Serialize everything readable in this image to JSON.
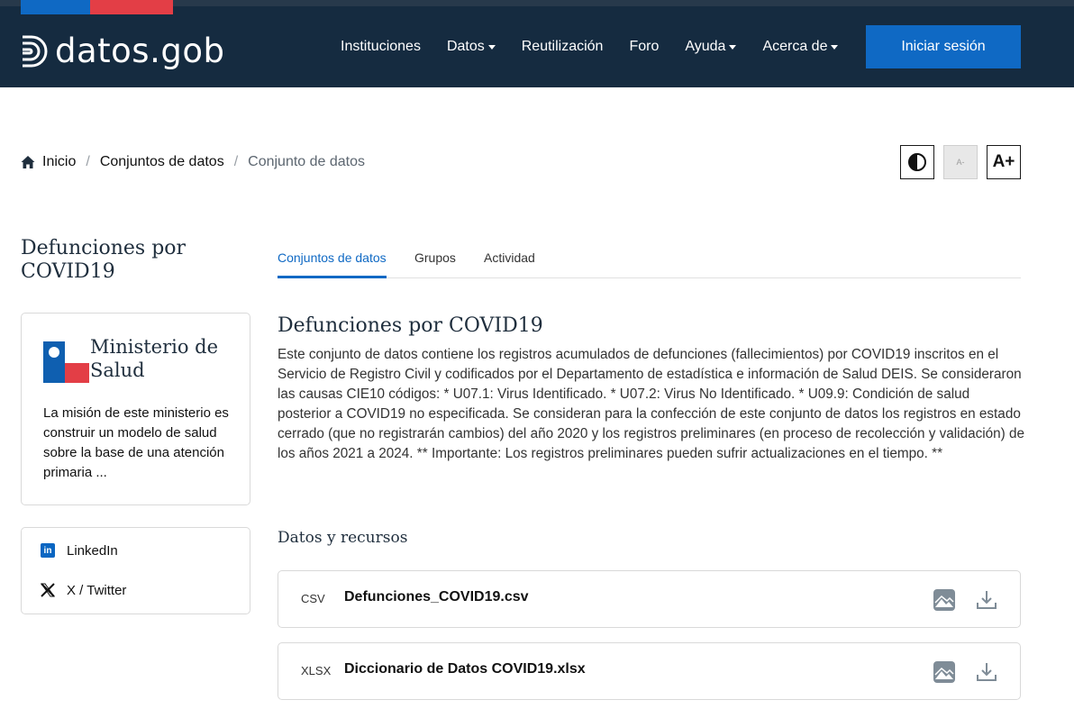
{
  "header": {
    "logo_text": "datos.gob",
    "nav": [
      {
        "label": "Instituciones"
      },
      {
        "label": "Datos"
      },
      {
        "label": "Reutilización"
      },
      {
        "label": "Foro"
      },
      {
        "label": "Ayuda"
      },
      {
        "label": "Acerca de"
      }
    ],
    "login_label": "Iniciar sesión"
  },
  "breadcrumb": {
    "home": "Inicio",
    "section": "Conjuntos de datos",
    "current": "Conjunto de datos"
  },
  "accessibility": {
    "smaller_label": "A-",
    "bigger_label": "A+"
  },
  "sidebar": {
    "title": "Defunciones por COVID19",
    "org_name": "Ministerio de Salud",
    "org_description": "La misión de este ministerio es construir un modelo de salud sobre la base de una atención primaria ...",
    "social": [
      {
        "label": "LinkedIn"
      },
      {
        "label": "X / Twitter"
      }
    ]
  },
  "tabs": [
    {
      "label": "Conjuntos de datos"
    },
    {
      "label": "Grupos"
    },
    {
      "label": "Actividad"
    }
  ],
  "dataset": {
    "title": "Defunciones por COVID19",
    "description": "Este conjunto de datos contiene los registros acumulados de defunciones (fallecimientos) por COVID19 inscritos en el Servicio de Registro Civil y codificados por el Departamento de estadística e información de Salud DEIS. Se consideraron las causas CIE10 códigos: * U07.1: Virus Identificado. * U07.2: Virus No Identificado. * U09.9: Condición de salud posterior a COVID19 no especificada. Se consideran para la confección de este conjunto de datos los registros en estado cerrado (que no registrarán cambios) del año 2020 y los registros preliminares (en proceso de recolección y validación) de los años 2021 a 2024. ** Importante: Los registros preliminares pueden sufrir actualizaciones en el tiempo. **"
  },
  "resources": {
    "heading": "Datos y recursos",
    "items": [
      {
        "format": "CSV",
        "name": "Defunciones_COVID19.csv"
      },
      {
        "format": "XLSX",
        "name": "Diccionario de Datos COVID19.xlsx"
      }
    ]
  },
  "colors": {
    "header_bg": "#152b40",
    "primary": "#0f69c4",
    "flag_red": "#e33e46"
  }
}
